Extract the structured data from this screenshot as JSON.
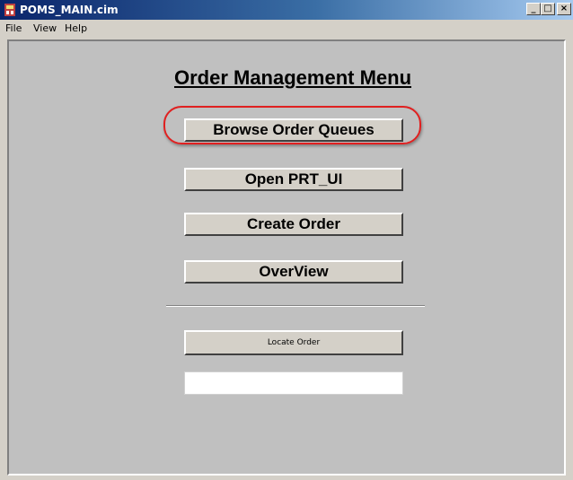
{
  "window": {
    "title": "POMS_MAIN.cim",
    "controls": {
      "minimize": "_",
      "maximize": "□",
      "close": "×"
    }
  },
  "menubar": {
    "items": [
      {
        "label": "File"
      },
      {
        "label": "View"
      },
      {
        "label": "Help"
      }
    ]
  },
  "main": {
    "heading": "Order Management Menu",
    "buttons": {
      "browse_queues": "Browse Order Queues",
      "open_prt_ui": "Open PRT_UI",
      "create_order": "Create Order",
      "overview": "OverView",
      "locate_order": "Locate Order"
    },
    "highlighted_button": "Browse Order Queues",
    "highlight_color": "#e02020",
    "locate_input": {
      "value": "",
      "placeholder": ""
    }
  },
  "colors": {
    "titlebar_start": "#0a246a",
    "window_bg": "#d4d0c8",
    "client_bg": "#c0c0c0"
  },
  "icons": {
    "app": "app-icon"
  }
}
